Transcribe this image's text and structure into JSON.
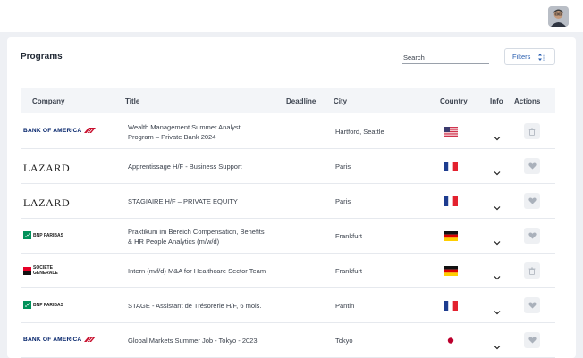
{
  "header": {
    "avatar": "user-avatar"
  },
  "page": {
    "title": "Programs"
  },
  "search": {
    "placeholder": "Search"
  },
  "filters": {
    "label": "Filters"
  },
  "table": {
    "columns": [
      "Company",
      "Title",
      "Deadline",
      "City",
      "Country",
      "Info",
      "Actions"
    ],
    "rows": [
      {
        "company": "BANK OF AMERICA",
        "logo": "boa",
        "title_line1": "Wealth Management Summer Analyst",
        "title_line2": "Program – Private Bank 2024",
        "deadline": "",
        "city": "Hartford, Seattle",
        "country_flag": "us",
        "action_icon": "trash-icon"
      },
      {
        "company": "LAZARD",
        "logo": "lazard",
        "title_line1": "Apprentissage H/F - Business Support",
        "title_line2": "",
        "deadline": "",
        "city": "Paris",
        "country_flag": "fr",
        "action_icon": "heart-icon"
      },
      {
        "company": "LAZARD",
        "logo": "lazard",
        "title_line1": "STAGIAIRE H/F – PRIVATE EQUITY",
        "title_line2": "",
        "deadline": "",
        "city": "Paris",
        "country_flag": "fr",
        "action_icon": "heart-icon"
      },
      {
        "company": "BNP PARIBAS",
        "logo": "bnp",
        "title_line1": "Praktikum im Bereich Compensation, Benefits",
        "title_line2": "& HR People Analytics (m/w/d)",
        "deadline": "",
        "city": "Frankfurt",
        "country_flag": "de",
        "action_icon": "heart-icon"
      },
      {
        "company": "SOCIETE GENERALE",
        "logo": "sg",
        "title_line1": "Intern (m/f/d) M&A for Healthcare Sector Team",
        "title_line2": "",
        "deadline": "",
        "city": "Frankfurt",
        "country_flag": "de",
        "action_icon": "trash-icon"
      },
      {
        "company": "BNP PARIBAS",
        "logo": "bnp",
        "title_line1": "STAGE - Assistant de Trésorerie H/F, 6 mois.",
        "title_line2": "",
        "deadline": "",
        "city": "Pantin",
        "country_flag": "fr",
        "action_icon": "heart-icon"
      },
      {
        "company": "BANK OF AMERICA",
        "logo": "boa",
        "title_line1": "Global Markets Summer Job - Tokyo - 2023",
        "title_line2": "",
        "deadline": "",
        "city": "Tokyo",
        "country_flag": "jp",
        "action_icon": "heart-icon"
      }
    ]
  },
  "colors": {
    "accent": "#2a5fb0",
    "boa_red": "#c8102e",
    "boa_blue": "#012169",
    "bnp_green": "#00915a",
    "sg_red": "#e60028"
  }
}
